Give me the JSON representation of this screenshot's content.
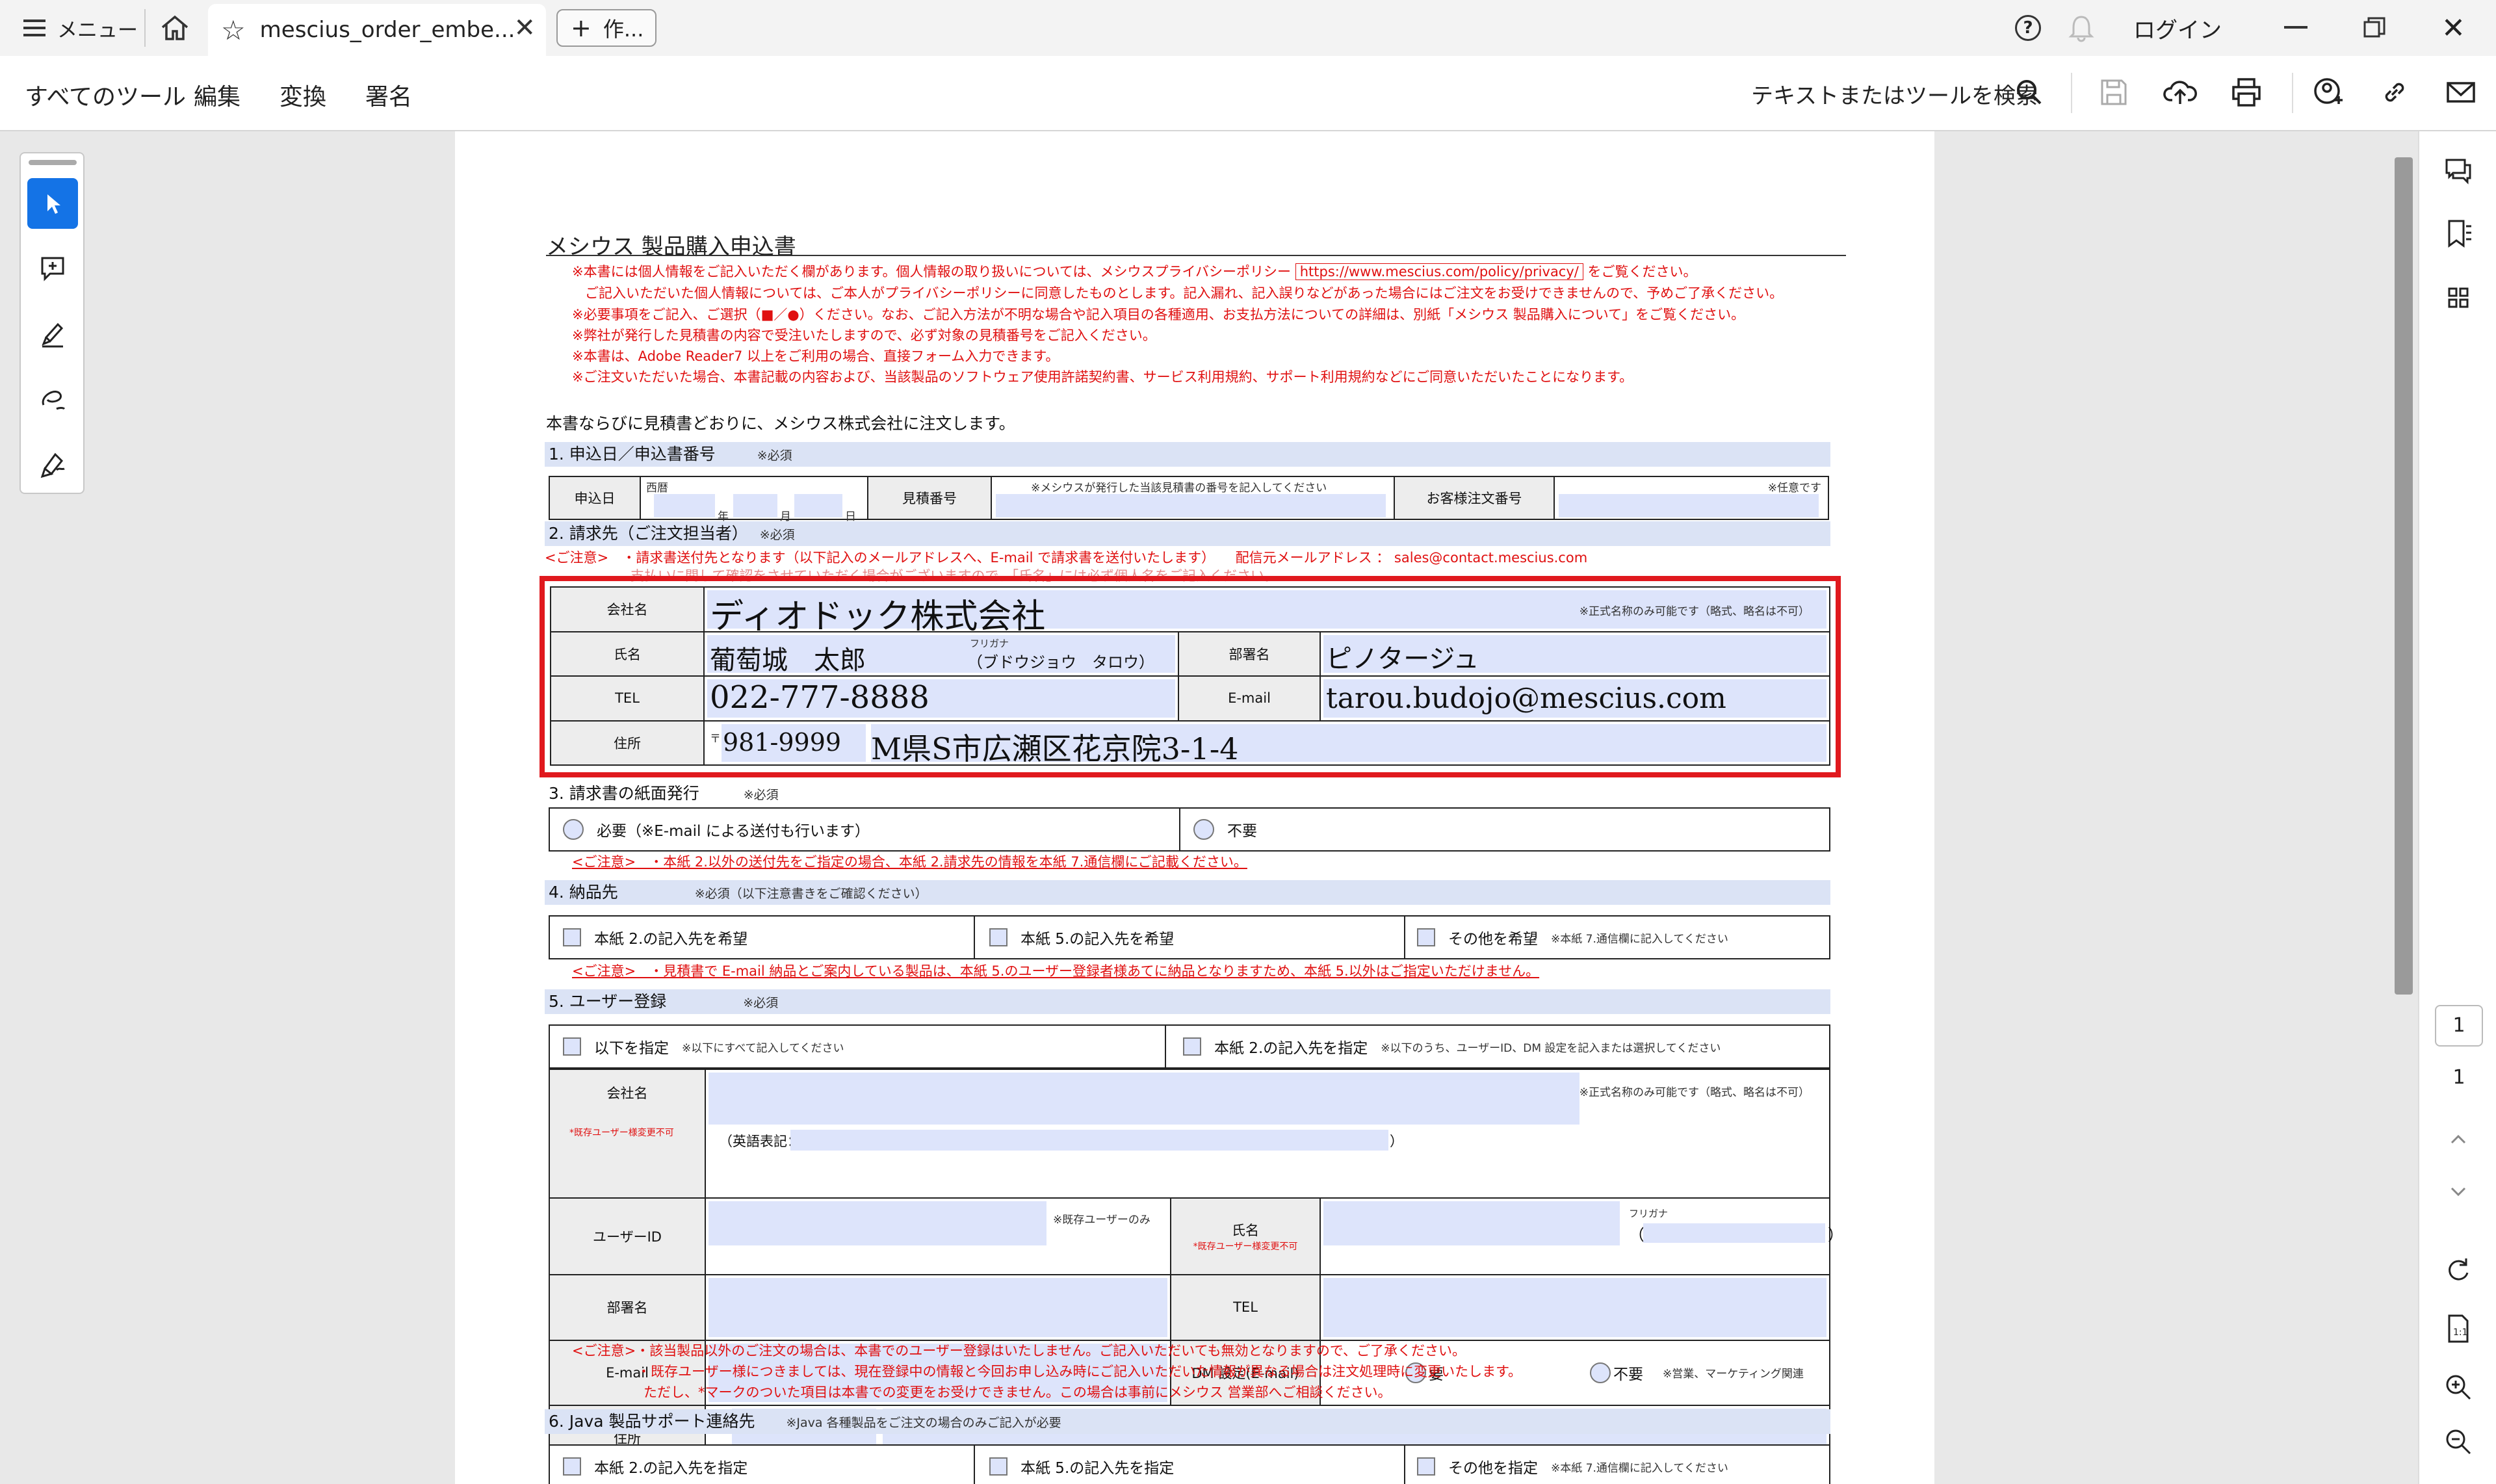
{
  "app": {
    "menu_label": "メニュー",
    "tab_title": "mescius_order_embe...",
    "new_tab_label": "作...",
    "login_label": "ログイン"
  },
  "toolbar": {
    "menu_items": [
      "すべてのツール",
      "編集",
      "変換",
      "署名"
    ],
    "search_label": "テキストまたはツールを検索"
  },
  "document": {
    "title": "メシウス 製品購入申込書",
    "notices": [
      "※本書には個人情報をご記入いただく欄があります。個人情報の取り扱いについては、メシウスプライバシーポリシー",
      "https://www.mescius.com/policy/privacy/",
      "をご覧ください。",
      "ご記入いただいた個人情報については、ご本人がプライバシーポリシーに同意したものとします。記入漏れ、記入誤りなどがあった場合にはご注文をお受けできませんので、予めご了承ください。",
      "※必要事項をご記入、ご選択（■／●）ください。なお、ご記入方法が不明な場合や記入項目の各種適用、お支払方法についての詳細は、別紙「メシウス 製品購入について」をご覧ください。",
      "※弊社が発行した見積書の内容で受注いたしますので、必ず対象の見積番号をご記入ください。",
      "※本書は、Adobe Reader7 以上をご利用の場合、直接フォーム入力できます。",
      "※ご注文いただいた場合、本書記載の内容および、当該製品のソフトウェア使用許諾契約書、サービス利用規約、サポート利用規約などにご同意いただいたことになります。"
    ],
    "intro": "本書ならびに見積書どおりに、メシウス株式会社に注文します。",
    "required": "※必須",
    "sec1": {
      "title": "1. 申込日／申込書番号",
      "date_label": "申込日",
      "seireki": "西暦",
      "year": "年",
      "month": "月",
      "day": "日",
      "quote_label": "見積番号",
      "quote_hint": "※メシウスが発行した当該見積書の番号を記入してください",
      "order_label": "お客様注文番号",
      "order_hint": "※任意です"
    },
    "sec2": {
      "title": "2. 請求先（ご注文担当者）",
      "caution": "<ご注意>　・請求書送付先となります（以下記入のメールアドレスへ、E-mail で請求書を送付いたします）　　配信元メールアドレス ： sales@contact.mescius.com",
      "caution2": "支払いに関して確認をさせていただく場合がございますので、「氏名」には必ず個人名をご記入ください。",
      "company_label": "会社名",
      "company_value": "ディオドック株式会社",
      "company_hint": "※正式名称のみ可能です（略式、略名は不可）",
      "name_label": "氏名",
      "name_value": "葡萄城　太郎",
      "furigana_label": "フリガナ",
      "furigana_value": "（ブドウジョウ　タロウ）",
      "dept_label": "部署名",
      "dept_value": "ピノタージュ",
      "tel_label": "TEL",
      "tel_value": "022-777-8888",
      "email_label": "E-mail",
      "email_value": "tarou.budojo@mescius.com",
      "address_label": "住所",
      "postal_mark": "〒",
      "postal_value": "981-9999",
      "address_value": "M県S市広瀬区花京院3-1-4"
    },
    "sec3": {
      "title": "3. 請求書の紙面発行",
      "opt1": "必要（※E-mail による送付も行います）",
      "opt2": "不要",
      "caution": "<ご注意>　・本紙 2.以外の送付先をご指定の場合、本紙 2.請求先の情報を本紙 7.通信欄にご記載ください。"
    },
    "sec4": {
      "title": "4. 納品先",
      "req": "※必須（以下注意書きをご確認ください）",
      "opt1": "本紙 2.の記入先を希望",
      "opt2": "本紙 5.の記入先を希望",
      "opt3": "その他を希望",
      "opt3_hint": "※本紙 7.通信欄に記入してください",
      "caution": "<ご注意>　・見積書で E-mail 納品とご案内している製品は、本紙 5.のユーザー登録者様あてに納品となりますため、本紙 5.以外はご指定いただけません。"
    },
    "sec5": {
      "title": "5. ユーザー登録",
      "opt1": "以下を指定",
      "opt1_hint": "※以下にすべて記入してください",
      "opt2": "本紙 2.の記入先を指定",
      "opt2_hint": "※以下のうち、ユーザーID、DM 設定を記入または選択してください",
      "company_label": "会社名",
      "existing_note": "*既存ユーザー様変更不可",
      "company_hint": "※正式名称のみ可能です（略式、略名は不可）",
      "english": "（英語表記：",
      "english_close": "）",
      "userid_label": "ユーザーID",
      "userid_hint": "※既存ユーザーのみ",
      "name_label": "氏名",
      "furigana_label": "フリガナ",
      "paren_open": "（",
      "paren_close": "）",
      "dept_label": "部署名",
      "tel_label": "TEL",
      "email_label": "E-mail",
      "dm_label": "DM 設定(E-mail)",
      "dm_yes": "要",
      "dm_no": "不要",
      "dm_hint": "※営業、マーケティング関連",
      "address_label": "住所",
      "postal_mark": "〒",
      "cautions": [
        "<ご注意>・該当製品以外のご注文の場合は、本書でのユーザー登録はいたしません。ご記入いただいても無効となりますので、ご了承ください。",
        "・既存ユーザー様につきましては、現在登録中の情報と今回お申し込み時にご記入いただいた情報が異なる場合は注文処理時に変更いたします。",
        "ただし、*マークのついた項目は本書での変更をお受けできません。この場合は事前にメシウス 営業部へご相談ください。"
      ]
    },
    "sec6": {
      "title": "6. Java 製品サポート連絡先",
      "req": "※Java 各種製品をご注文の場合のみご記入が必要",
      "opt1": "本紙 2.の記入先を指定",
      "opt2": "本紙 5.の記入先を指定",
      "opt3": "その他を指定",
      "opt3_hint": "※本紙 7.通信欄に記入してください"
    }
  },
  "page_nav": {
    "current": "1",
    "total": "1"
  }
}
